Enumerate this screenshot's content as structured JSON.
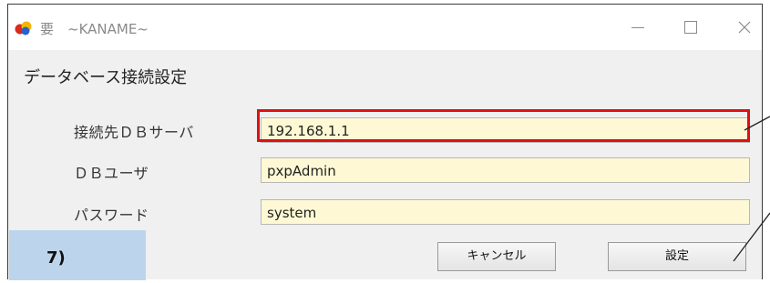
{
  "window": {
    "title": "要　~KANAME~"
  },
  "dialog": {
    "heading": "データベース接続設定",
    "fields": [
      {
        "label": "接続先ＤＢサーバ",
        "value": "192.168.1.1"
      },
      {
        "label": "ＤＢユーザ",
        "value": "pxpAdmin"
      },
      {
        "label": "パスワード",
        "value": "system"
      }
    ],
    "buttons": {
      "cancel": "キャンセル",
      "set": "設定"
    }
  },
  "annotation": {
    "step_label": "7)",
    "highlight_color": "#e01010",
    "box_color": "#bcd5ec"
  },
  "icons": {
    "app": "app-logo-icon",
    "minimize": "minimize-icon",
    "maximize": "maximize-icon",
    "close": "close-icon"
  }
}
